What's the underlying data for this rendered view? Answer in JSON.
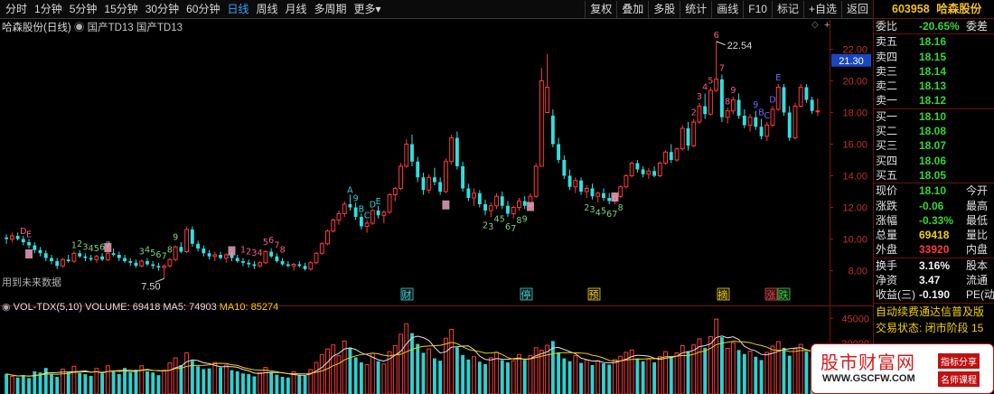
{
  "toolbar": {
    "periods": [
      "分时",
      "1分钟",
      "5分钟",
      "15分钟",
      "30分钟",
      "60分钟",
      "日线",
      "周线",
      "月线",
      "多周期",
      "更多▾"
    ],
    "active_period": "日线",
    "tools": [
      "复权",
      "叠加",
      "多股",
      "统计",
      "画线",
      "F10",
      "标记",
      "+自选",
      "返回"
    ]
  },
  "chart": {
    "title": "哈森股份(日线)",
    "indicator": "国产TD13 国产TD13",
    "future_label": "用到未来数据",
    "high_label": "22.54",
    "low_label": "7.50",
    "cursor_price": "21.30",
    "axis_ticks": [
      "22.00",
      "20.00",
      "18.00",
      "16.00",
      "14.00",
      "12.00",
      "10.00",
      "8.00"
    ],
    "markers": [
      {
        "text": "财",
        "color": "#30d0d0"
      },
      {
        "text": "停",
        "color": "#30d0d0"
      },
      {
        "text": "预",
        "color": "#f4d000"
      },
      {
        "text": "摘",
        "color": "#f4d000"
      },
      {
        "text": "涨",
        "color": "#ff3b3b"
      },
      {
        "text": "跌",
        "color": "#33d733"
      }
    ]
  },
  "volume": {
    "title": "VOL-TDX(5,10)",
    "volume_label": "VOLUME: 69418",
    "ma5_label": "MA5: 74903",
    "ma10_label": "MA10: 85274",
    "axis_ticks": [
      "45000",
      "30000"
    ],
    "colors": {
      "up": "#ff3b3b",
      "down": "#30d0d0",
      "ma5": "#e0e0e0",
      "ma10": "#f4d000"
    }
  },
  "panel": {
    "code": "603958",
    "name": "哈森股份",
    "weibi_label": "委比",
    "weibi_value": "-20.65%",
    "weicha_label": "委差",
    "asks": [
      {
        "label": "卖五",
        "price": "18.16"
      },
      {
        "label": "卖四",
        "price": "18.15"
      },
      {
        "label": "卖三",
        "price": "18.14"
      },
      {
        "label": "卖二",
        "price": "18.13"
      },
      {
        "label": "卖一",
        "price": "18.12"
      }
    ],
    "bids": [
      {
        "label": "买一",
        "price": "18.10"
      },
      {
        "label": "买二",
        "price": "18.08"
      },
      {
        "label": "买三",
        "price": "18.07"
      },
      {
        "label": "买四",
        "price": "18.06"
      },
      {
        "label": "买五",
        "price": "18.05"
      }
    ],
    "stats": [
      {
        "label": "现价",
        "value": "18.10",
        "label2": "今开",
        "color": "green"
      },
      {
        "label": "涨跌",
        "value": "-0.06",
        "label2": "最高",
        "color": "green"
      },
      {
        "label": "涨幅",
        "value": "-0.33%",
        "label2": "最低",
        "color": "green"
      },
      {
        "label": "总量",
        "value": "69418",
        "label2": "量比",
        "color": "yellow"
      },
      {
        "label": "外盘",
        "value": "33920",
        "label2": "内盘",
        "color": "red"
      }
    ],
    "stats2": [
      {
        "label": "换手",
        "value": "3.16%",
        "label2": "股本"
      },
      {
        "label": "净资",
        "value": "3.47",
        "label2": "流通"
      },
      {
        "label": "收益(三)",
        "value": "-0.190",
        "label2": "PE(动"
      }
    ],
    "notice1": "自动续费通达信普及版",
    "notice2": "交易状态: 闭市阶段 15"
  },
  "watermark": {
    "logo": "股市财富网",
    "url": "WWW.GSCFW.COM",
    "tag1": "指标分享",
    "tag2": "名师课程"
  },
  "chart_data": {
    "type": "candlestick",
    "y_range": [
      7.0,
      23.0
    ],
    "candles": [
      [
        10.1,
        10.3,
        9.7,
        10.0
      ],
      [
        10.0,
        10.4,
        9.8,
        10.2
      ],
      [
        10.2,
        10.4,
        9.9,
        10.0
      ],
      [
        10.0,
        10.2,
        9.6,
        9.8
      ],
      [
        9.8,
        10.0,
        9.4,
        9.6
      ],
      [
        9.6,
        9.8,
        9.1,
        9.3
      ],
      [
        9.3,
        9.5,
        8.9,
        9.1
      ],
      [
        9.1,
        9.3,
        8.6,
        8.8
      ],
      [
        8.8,
        9.0,
        8.4,
        8.6
      ],
      [
        8.6,
        8.8,
        8.1,
        8.3
      ],
      [
        8.3,
        8.8,
        8.2,
        8.7
      ],
      [
        8.7,
        9.0,
        8.5,
        8.6
      ],
      [
        8.6,
        9.2,
        8.5,
        9.1
      ],
      [
        9.1,
        9.3,
        8.8,
        8.9
      ],
      [
        8.9,
        9.1,
        8.6,
        8.8
      ],
      [
        8.8,
        9.0,
        8.6,
        8.7
      ],
      [
        8.7,
        9.0,
        8.5,
        8.9
      ],
      [
        8.9,
        9.1,
        8.6,
        8.7
      ],
      [
        8.7,
        9.2,
        8.6,
        9.1
      ],
      [
        9.1,
        9.4,
        8.9,
        9.0
      ],
      [
        9.0,
        9.2,
        8.6,
        8.8
      ],
      [
        8.8,
        9.0,
        8.5,
        8.6
      ],
      [
        8.6,
        8.8,
        8.3,
        8.5
      ],
      [
        8.5,
        8.7,
        8.2,
        8.3
      ],
      [
        8.3,
        8.7,
        8.2,
        8.6
      ],
      [
        8.6,
        8.8,
        8.3,
        8.4
      ],
      [
        8.4,
        8.6,
        8.1,
        8.3
      ],
      [
        8.3,
        8.5,
        8.0,
        8.2
      ],
      [
        8.2,
        8.4,
        7.5,
        8.3
      ],
      [
        8.3,
        8.8,
        8.2,
        8.7
      ],
      [
        8.7,
        9.6,
        8.6,
        9.5
      ],
      [
        9.5,
        9.8,
        9.1,
        9.2
      ],
      [
        9.2,
        10.8,
        9.1,
        10.6
      ],
      [
        10.6,
        10.8,
        9.5,
        9.7
      ],
      [
        9.7,
        9.9,
        9.2,
        9.4
      ],
      [
        9.4,
        9.6,
        8.9,
        9.1
      ],
      [
        9.1,
        9.3,
        8.7,
        8.9
      ],
      [
        8.9,
        9.2,
        8.6,
        9.0
      ],
      [
        9.0,
        9.2,
        8.7,
        8.8
      ],
      [
        8.8,
        9.1,
        8.5,
        9.0
      ],
      [
        9.0,
        9.2,
        8.6,
        8.8
      ],
      [
        8.8,
        9.0,
        8.5,
        8.6
      ],
      [
        8.6,
        8.8,
        8.3,
        8.5
      ],
      [
        8.5,
        8.7,
        8.2,
        8.4
      ],
      [
        8.4,
        8.6,
        8.1,
        8.3
      ],
      [
        8.3,
        8.6,
        8.2,
        8.5
      ],
      [
        8.5,
        9.3,
        8.4,
        9.2
      ],
      [
        9.2,
        9.4,
        8.8,
        8.9
      ],
      [
        8.9,
        9.1,
        8.5,
        8.6
      ],
      [
        8.6,
        8.8,
        8.3,
        8.4
      ],
      [
        8.4,
        8.6,
        8.2,
        8.3
      ],
      [
        8.3,
        8.5,
        8.0,
        8.4
      ],
      [
        8.4,
        8.6,
        8.2,
        8.3
      ],
      [
        8.3,
        8.5,
        8.0,
        8.1
      ],
      [
        8.1,
        8.6,
        8.0,
        8.5
      ],
      [
        8.5,
        9.2,
        8.4,
        9.1
      ],
      [
        9.1,
        9.8,
        9.0,
        9.7
      ],
      [
        9.7,
        10.6,
        9.6,
        10.5
      ],
      [
        10.5,
        11.3,
        10.4,
        11.2
      ],
      [
        11.2,
        11.8,
        10.9,
        11.6
      ],
      [
        11.6,
        12.4,
        11.4,
        12.2
      ],
      [
        12.2,
        12.8,
        11.8,
        12.0
      ],
      [
        12.0,
        12.3,
        11.2,
        11.4
      ],
      [
        11.4,
        11.6,
        10.6,
        10.8
      ],
      [
        10.8,
        11.2,
        10.4,
        11.0
      ],
      [
        11.0,
        11.9,
        10.9,
        11.8
      ],
      [
        11.8,
        12.1,
        11.3,
        11.5
      ],
      [
        11.5,
        11.8,
        11.0,
        11.7
      ],
      [
        11.7,
        12.9,
        11.6,
        12.8
      ],
      [
        12.8,
        13.3,
        12.4,
        13.2
      ],
      [
        13.2,
        14.8,
        13.1,
        14.6
      ],
      [
        14.6,
        16.3,
        14.5,
        16.0
      ],
      [
        16.0,
        16.6,
        14.6,
        14.9
      ],
      [
        14.9,
        15.2,
        13.6,
        13.9
      ],
      [
        13.9,
        14.2,
        12.8,
        13.1
      ],
      [
        13.1,
        14.1,
        12.9,
        13.9
      ],
      [
        13.9,
        14.5,
        13.4,
        13.6
      ],
      [
        13.6,
        13.9,
        12.8,
        13.0
      ],
      [
        13.0,
        15.1,
        12.9,
        14.9
      ],
      [
        14.9,
        16.6,
        14.7,
        16.4
      ],
      [
        16.4,
        16.8,
        14.4,
        14.6
      ],
      [
        14.6,
        14.9,
        13.0,
        13.2
      ],
      [
        13.2,
        13.5,
        12.4,
        12.6
      ],
      [
        12.6,
        13.2,
        12.1,
        12.9
      ],
      [
        12.9,
        13.1,
        12.0,
        12.2
      ],
      [
        12.2,
        12.5,
        11.5,
        11.8
      ],
      [
        11.8,
        12.3,
        11.4,
        12.1
      ],
      [
        12.1,
        12.9,
        11.9,
        12.7
      ],
      [
        12.7,
        13.0,
        11.9,
        12.1
      ],
      [
        12.1,
        12.4,
        11.4,
        11.6
      ],
      [
        11.6,
        12.1,
        11.3,
        12.0
      ],
      [
        12.0,
        12.6,
        11.8,
        12.4
      ],
      [
        12.4,
        12.7,
        11.9,
        12.1
      ],
      [
        12.1,
        12.9,
        12.0,
        12.7
      ],
      [
        12.7,
        14.8,
        12.6,
        14.6
      ],
      [
        14.6,
        20.8,
        18.0,
        20.0
      ],
      [
        18.0,
        21.7,
        18.0,
        19.6
      ],
      [
        17.8,
        18.2,
        15.8,
        16.0
      ],
      [
        16.0,
        16.4,
        14.8,
        15.0
      ],
      [
        15.0,
        15.3,
        13.8,
        14.0
      ],
      [
        14.0,
        14.4,
        13.1,
        13.3
      ],
      [
        13.3,
        13.9,
        12.9,
        13.7
      ],
      [
        13.7,
        13.9,
        12.8,
        13.0
      ],
      [
        13.0,
        13.4,
        12.6,
        13.2
      ],
      [
        13.2,
        13.5,
        12.5,
        12.7
      ],
      [
        12.7,
        13.0,
        12.3,
        12.9
      ],
      [
        12.9,
        13.2,
        12.4,
        12.6
      ],
      [
        12.6,
        12.9,
        12.2,
        12.4
      ],
      [
        12.4,
        12.8,
        12.2,
        12.7
      ],
      [
        12.7,
        13.4,
        12.6,
        13.3
      ],
      [
        13.3,
        14.1,
        13.2,
        14.0
      ],
      [
        14.0,
        14.9,
        13.9,
        14.8
      ],
      [
        14.8,
        15.0,
        14.2,
        14.4
      ],
      [
        14.4,
        14.6,
        13.9,
        14.1
      ],
      [
        14.1,
        14.5,
        13.8,
        14.3
      ],
      [
        14.3,
        14.6,
        13.9,
        14.0
      ],
      [
        14.0,
        14.9,
        13.9,
        14.8
      ],
      [
        14.8,
        15.6,
        14.7,
        15.5
      ],
      [
        15.5,
        16.0,
        14.8,
        15.0
      ],
      [
        15.0,
        15.8,
        14.9,
        15.7
      ],
      [
        15.7,
        17.2,
        15.6,
        17.0
      ],
      [
        17.0,
        17.4,
        15.6,
        15.9
      ],
      [
        15.9,
        17.6,
        15.8,
        17.4
      ],
      [
        17.4,
        18.6,
        17.3,
        18.4
      ],
      [
        18.4,
        19.2,
        17.6,
        17.9
      ],
      [
        17.9,
        19.6,
        17.8,
        19.4
      ],
      [
        19.4,
        22.5,
        19.3,
        20.1
      ],
      [
        20.1,
        20.4,
        17.4,
        17.7
      ],
      [
        17.7,
        18.3,
        17.3,
        18.1
      ],
      [
        18.1,
        19.0,
        17.9,
        18.8
      ],
      [
        18.8,
        19.2,
        17.6,
        17.8
      ],
      [
        17.8,
        18.2,
        17.0,
        17.2
      ],
      [
        17.2,
        17.9,
        16.8,
        17.7
      ],
      [
        17.7,
        18.1,
        16.9,
        17.1
      ],
      [
        17.1,
        17.6,
        16.3,
        16.5
      ],
      [
        16.5,
        17.4,
        16.2,
        17.2
      ],
      [
        17.2,
        18.4,
        17.1,
        18.2
      ],
      [
        18.2,
        19.8,
        18.1,
        19.6
      ],
      [
        19.6,
        19.8,
        17.8,
        18.0
      ],
      [
        18.0,
        18.4,
        16.2,
        16.4
      ],
      [
        16.4,
        18.6,
        16.3,
        18.4
      ],
      [
        18.4,
        19.8,
        18.3,
        19.6
      ],
      [
        19.6,
        19.8,
        18.6,
        18.8
      ],
      [
        18.8,
        19.0,
        17.9,
        18.1
      ],
      [
        18.1,
        18.9,
        17.8,
        18.1
      ]
    ],
    "volumes": [
      12000,
      10500,
      9800,
      11200,
      9500,
      13500,
      12800,
      15500,
      11800,
      10200,
      14800,
      13200,
      16500,
      12500,
      11800,
      10800,
      15200,
      12200,
      16800,
      13800,
      11800,
      15500,
      12800,
      14500,
      16800,
      13500,
      12800,
      11200,
      14200,
      18500,
      21500,
      17200,
      24500,
      19800,
      16500,
      14800,
      15200,
      18800,
      15800,
      17200,
      14200,
      13500,
      12200,
      11800,
      10500,
      12800,
      15800,
      13200,
      11500,
      10200,
      9800,
      13200,
      11500,
      10800,
      14500,
      18800,
      23500,
      26800,
      29200,
      22800,
      31500,
      27200,
      21800,
      18800,
      17500,
      24200,
      19500,
      17800,
      25200,
      28800,
      35500,
      41800,
      36200,
      29800,
      24500,
      26800,
      21200,
      19800,
      33200,
      38500,
      27800,
      23200,
      20500,
      22200,
      19200,
      17800,
      21500,
      24800,
      20200,
      18800,
      19800,
      23500,
      20200,
      22800,
      27500,
      26000,
      29000,
      31500,
      24800,
      21200,
      19500,
      22800,
      18500,
      20200,
      17200,
      19800,
      18200,
      17500,
      20500,
      22500,
      24800,
      26200,
      21200,
      19500,
      20800,
      18800,
      22200,
      25200,
      21800,
      24500,
      28800,
      25500,
      29200,
      32800,
      27500,
      34200,
      44500,
      33800,
      27200,
      30500,
      26200,
      23800,
      25500,
      22200,
      20200,
      24800,
      28500,
      31200,
      27500,
      22800,
      26800,
      29500,
      25200,
      21800,
      20200
    ]
  }
}
